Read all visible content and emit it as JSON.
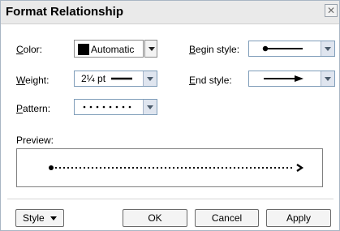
{
  "dialog": {
    "title": "Format Relationship",
    "close_icon": "close-icon"
  },
  "fields": {
    "color": {
      "label": "Color:",
      "accel": "C",
      "value": "Automatic"
    },
    "weight": {
      "label": "Weight:",
      "accel": "W",
      "value": "2¼ pt"
    },
    "pattern": {
      "label": "Pattern:",
      "accel": "P"
    },
    "begin_style": {
      "label": "Begin style:",
      "accel": "B"
    },
    "end_style": {
      "label": "End style:",
      "accel": "E"
    }
  },
  "preview": {
    "label": "Preview:"
  },
  "buttons": {
    "style": "Style",
    "ok": "OK",
    "cancel": "Cancel",
    "apply": "Apply"
  },
  "colors": {
    "titlebar": "#eaeaea",
    "field_border": "#7f9db9",
    "dropdown_bg": "#dfe5ef"
  }
}
